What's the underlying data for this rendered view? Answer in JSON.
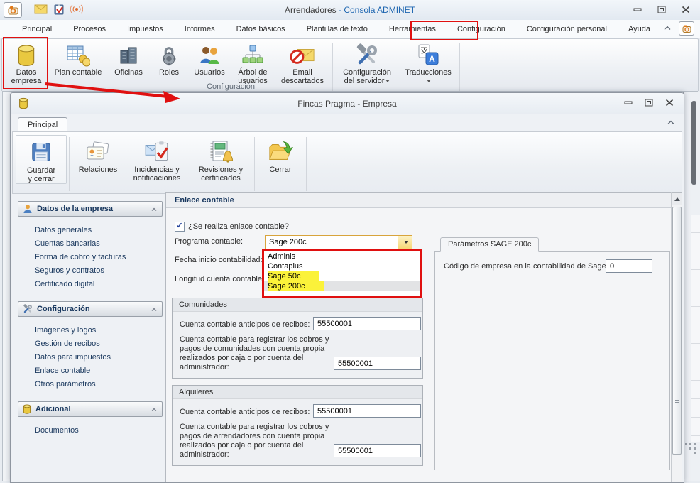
{
  "colors": {
    "annotation_red": "#e01010",
    "highlight_yellow": "#fbf23a",
    "title_blue": "#1e66b0"
  },
  "main_window": {
    "title_dark": "Arrendadores",
    "title_blue": " - Consola ADMINET",
    "tabs": [
      {
        "label": "Principal"
      },
      {
        "label": "Procesos"
      },
      {
        "label": "Impuestos"
      },
      {
        "label": "Informes"
      },
      {
        "label": "Datos básicos"
      },
      {
        "label": "Plantillas de texto"
      },
      {
        "label": "Herramientas"
      },
      {
        "label": "Configuración",
        "highlighted": true
      },
      {
        "label": "Configuración personal"
      },
      {
        "label": "Ayuda"
      }
    ],
    "ribbon": {
      "group_label": "Configuración",
      "buttons": [
        {
          "line1": "Datos",
          "line2": "empresa",
          "highlighted": true
        },
        {
          "line1": "Plan contable",
          "line2": ""
        },
        {
          "line1": "Oficinas",
          "line2": ""
        },
        {
          "line1": "Roles",
          "line2": ""
        },
        {
          "line1": "Usuarios",
          "line2": ""
        },
        {
          "line1": "Árbol de",
          "line2": "usuarios"
        },
        {
          "line1": "Email",
          "line2": "descartados"
        },
        {
          "line1": "Configuración",
          "line2": "del servidor",
          "dropdown": true
        },
        {
          "line1": "Traducciones",
          "line2": "",
          "dropdown": true
        }
      ]
    }
  },
  "child_window": {
    "title": "Fincas Pragma - Empresa",
    "tab": "Principal",
    "ribbon_buttons": [
      {
        "line1": "Guardar",
        "line2": "y cerrar"
      },
      {
        "line1": "Relaciones",
        "line2": ""
      },
      {
        "line1": "Incidencias y",
        "line2": "notificaciones"
      },
      {
        "line1": "Revisiones y",
        "line2": "certificados"
      },
      {
        "line1": "Cerrar",
        "line2": ""
      }
    ],
    "sidebar": {
      "sections": [
        {
          "title": "Datos de la empresa",
          "items": [
            "Datos generales",
            "Cuentas bancarias",
            "Forma de cobro y facturas",
            "Seguros y contratos",
            "Certificado digital"
          ]
        },
        {
          "title": "Configuración",
          "items": [
            "Imágenes y logos",
            "Gestión de recibos",
            "Datos para impuestos",
            "Enlace contable",
            "Otros parámetros"
          ]
        },
        {
          "title": "Adicional",
          "items": [
            "Documentos"
          ]
        }
      ]
    },
    "content": {
      "header": "Enlace contable",
      "checkbox_label": "¿Se realiza enlace contable?",
      "checkbox_checked": "✓",
      "program_label": "Programa contable:",
      "program_value": "Sage 200c",
      "fecha_label": "Fecha inicio contabilidad:",
      "longitud_label": "Longitud cuenta contable:",
      "dropdown_options": [
        {
          "label": "Adminis",
          "highlighted": false,
          "selected": false
        },
        {
          "label": "Contaplus",
          "highlighted": false,
          "selected": false
        },
        {
          "label": "Sage 50c",
          "highlighted": true,
          "selected": false
        },
        {
          "label": "Sage 200c",
          "highlighted": true,
          "selected": true
        }
      ],
      "sage_panel": {
        "tab": "Parámetros SAGE 200c",
        "code_label": "Código de empresa en la contabilidad de Sage:",
        "code_value": "0"
      },
      "groups": [
        {
          "title": "Comunidades",
          "anticipos_label": "Cuenta contable anticipos de recibos:",
          "anticipos_value": "55500001",
          "registro_lines": [
            "Cuenta contable para registrar los cobros y",
            "pagos de comunidades con cuenta propia",
            "realizados por caja o por cuenta del",
            "administrador:"
          ],
          "registro_value": "55500001"
        },
        {
          "title": "Alquileres",
          "anticipos_label": "Cuenta contable anticipos de recibos:",
          "anticipos_value": "55500001",
          "registro_lines": [
            "Cuenta contable para registrar los cobros y",
            "pagos de arrendadores con cuenta propia",
            "realizados por caja o por cuenta del",
            "administrador:"
          ],
          "registro_value": "55500001"
        }
      ]
    }
  }
}
